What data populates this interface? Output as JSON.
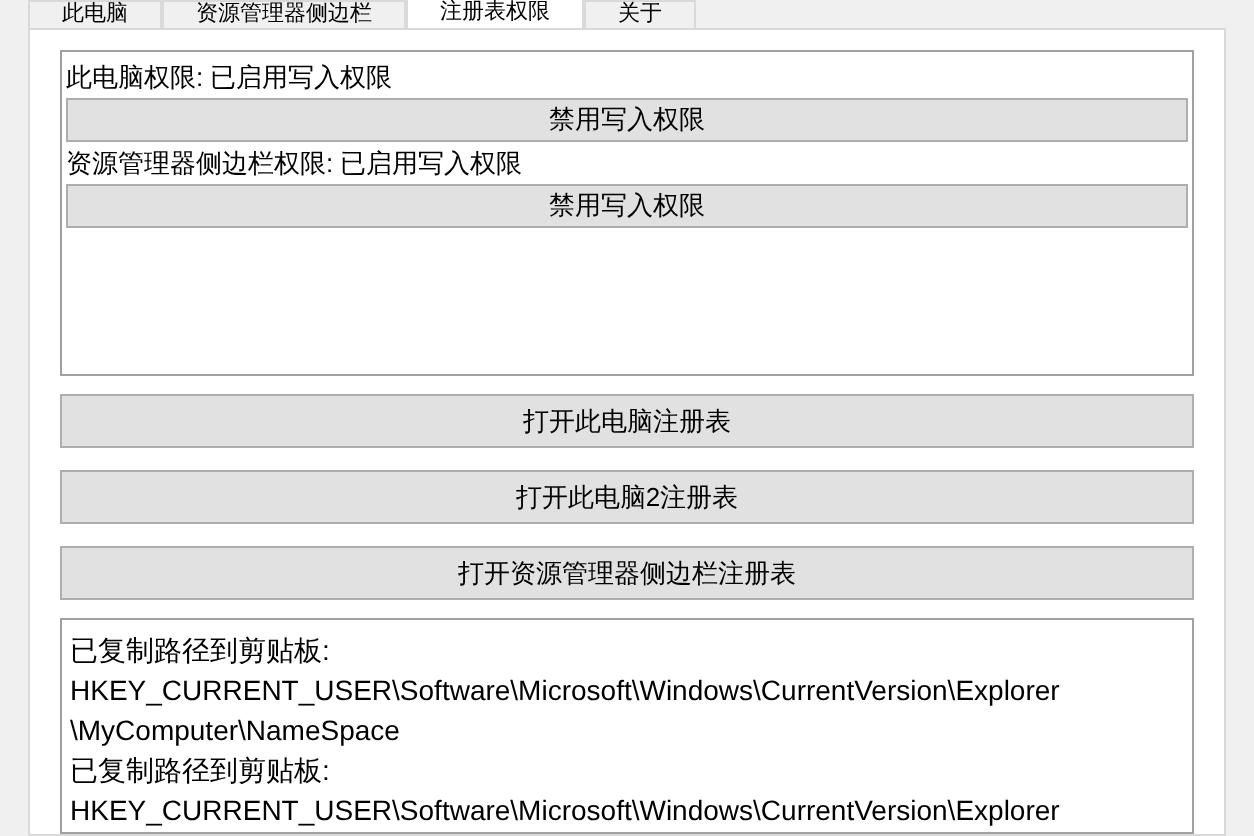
{
  "tabs": [
    {
      "label": "此电脑",
      "selected": false
    },
    {
      "label": "资源管理器侧边栏",
      "selected": false
    },
    {
      "label": "注册表权限",
      "selected": true
    },
    {
      "label": "关于",
      "selected": false
    }
  ],
  "permissions": [
    {
      "status": "此电脑权限: 已启用写入权限",
      "button": "禁用写入权限"
    },
    {
      "status": "资源管理器侧边栏权限: 已启用写入权限",
      "button": "禁用写入权限"
    }
  ],
  "buttons": [
    "打开此电脑注册表",
    "打开此电脑2注册表",
    "打开资源管理器侧边栏注册表"
  ],
  "log": [
    "已复制路径到剪贴板:",
    "HKEY_CURRENT_USER\\Software\\Microsoft\\Windows\\CurrentVersion\\Explorer",
    "\\MyComputer\\NameSpace",
    "已复制路径到剪贴板:",
    "HKEY_CURRENT_USER\\Software\\Microsoft\\Windows\\CurrentVersion\\Explorer"
  ]
}
